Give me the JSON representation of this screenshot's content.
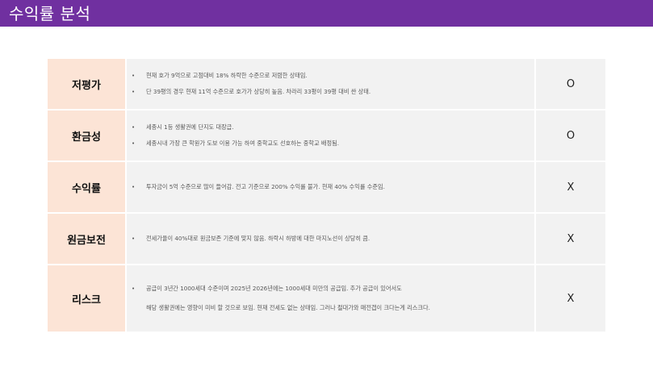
{
  "header": {
    "title": "수익률 분석"
  },
  "rows": [
    {
      "label": "저평가",
      "lines": [
        {
          "bullet": "•",
          "text": "현재 호가 9억으로 고점대비 18% 하락한 수준으로 저렴한 상태임."
        },
        {
          "bullet": "•",
          "text": "단 39평의 경우 현재 11억 수준으로 호가가 상당히 높음. 차라리 33평이 39평 대비 싼 상태."
        }
      ],
      "mark": "O"
    },
    {
      "label": "환금성",
      "lines": [
        {
          "bullet": "•",
          "text": "세종시 1등 생활권에 단지도 대장급."
        },
        {
          "bullet": "•",
          "text": " 세종시내 가장 큰 학원가 도보 이용 가능 하여 중학교도 선호하는 중학교 배정됨."
        }
      ],
      "mark": "O"
    },
    {
      "label": "수익률",
      "lines": [
        {
          "bullet": "•",
          "text": "투자금이 5억 수준으로 많이 들어감. 전고 기준으로 200% 수익률 불가. 현재 40% 수익률 수준임."
        }
      ],
      "mark": "X"
    },
    {
      "label": "원금보전",
      "lines": [
        {
          "bullet": "•",
          "text": "전세가율이 40%대로 원금보존 기준에 맞지 않음. 하락시 하방에 대한 마지노선이 상당히 큼."
        }
      ],
      "mark": "X"
    },
    {
      "label": "리스크",
      "lines": [
        {
          "bullet": "•",
          "text": "공급이 3년간 1000세대 수준이며 2025년 2026년에는 1000세대 미만의 공급임. 추가 공급이 있어서도"
        },
        {
          "bullet": "",
          "text": "해당 생활권에는 영향이 미비 할 것으로 보임. 현재 전세도 없는 상태임. 그러나 절대가와 매전갭이 크다는게 리스크다."
        }
      ],
      "mark": "X"
    }
  ]
}
